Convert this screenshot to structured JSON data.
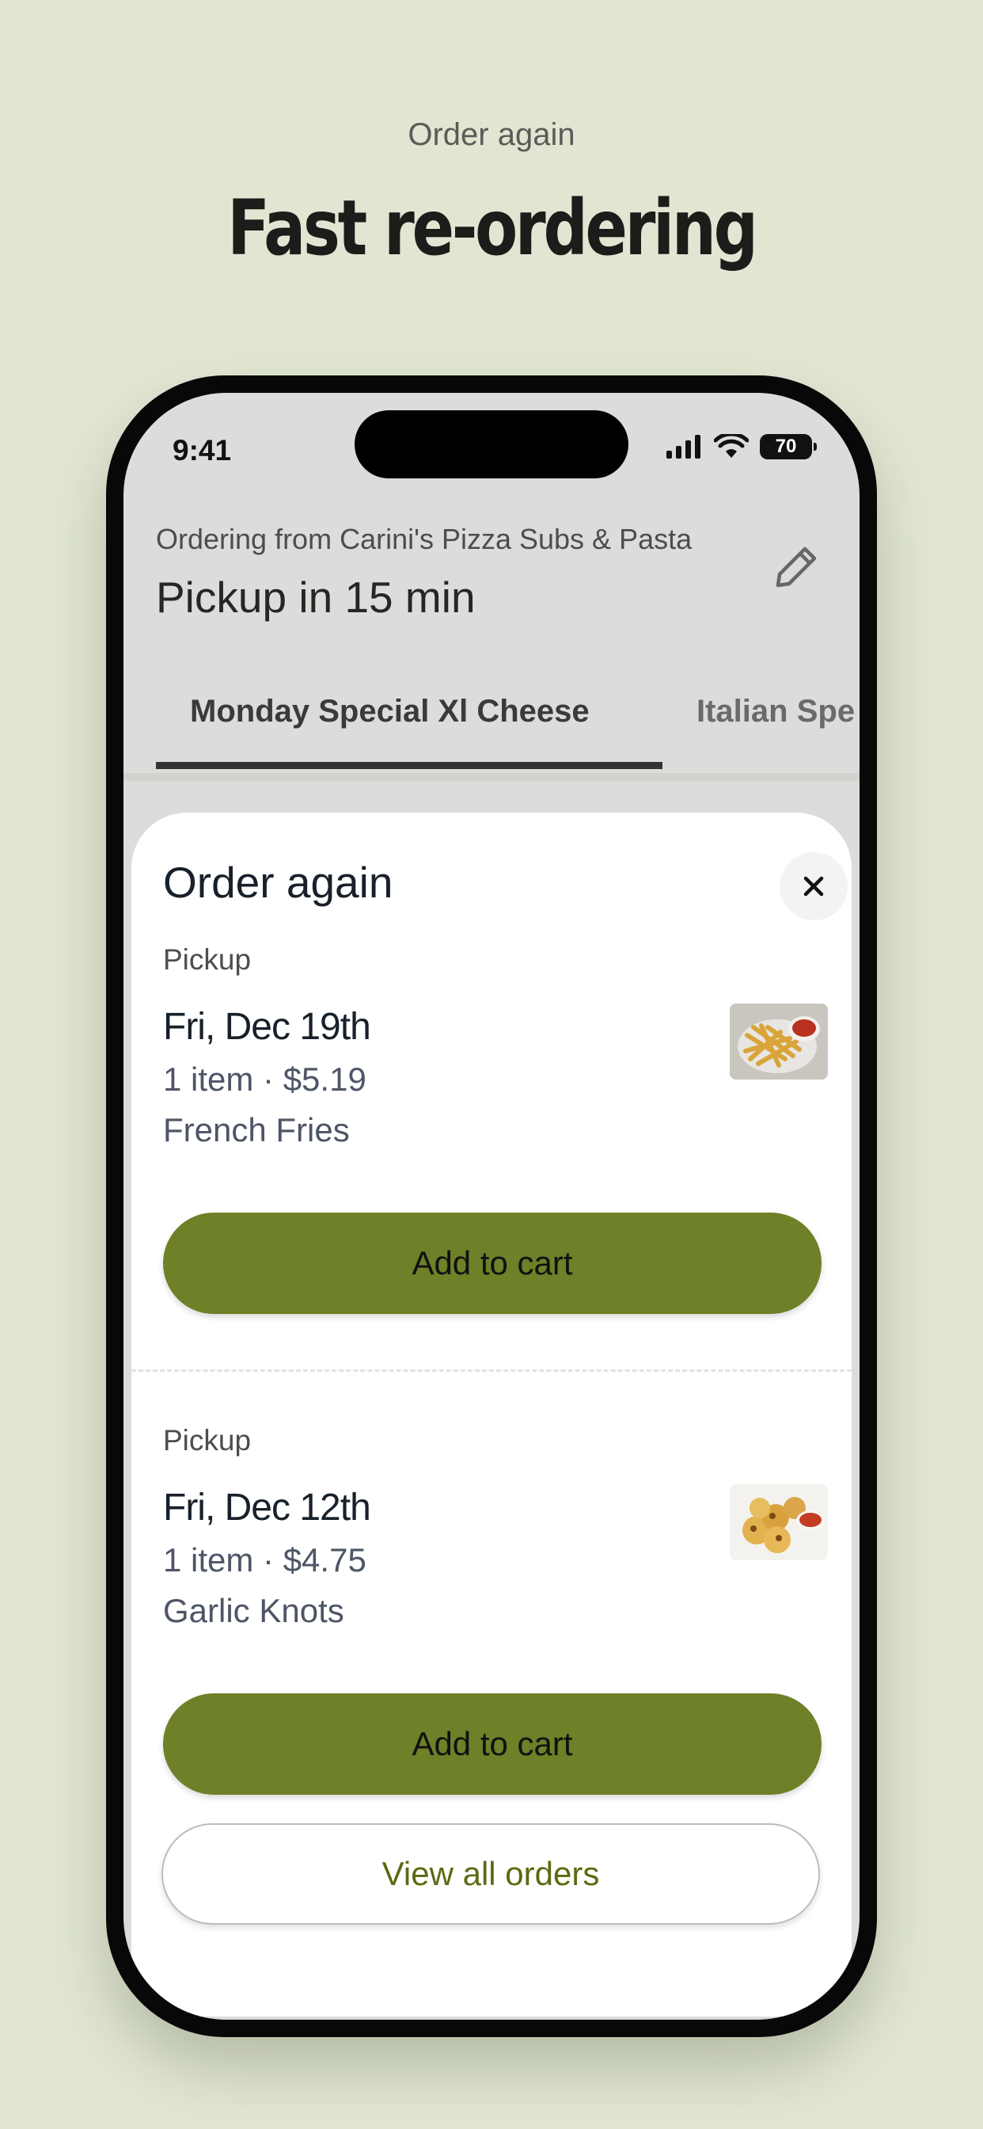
{
  "marketing": {
    "eyebrow": "Order again",
    "headline": "Fast re-ordering"
  },
  "status_bar": {
    "time": "9:41",
    "battery": "70",
    "icons": [
      "signal-icon",
      "wifi-icon",
      "battery-icon"
    ]
  },
  "header": {
    "ordering_from": "Ordering from Carini's Pizza Subs & Pasta",
    "pickup_time": "Pickup in 15 min",
    "edit_icon": "pencil-icon"
  },
  "tabs": [
    {
      "label": "Monday Special Xl Cheese",
      "active": true
    },
    {
      "label": "Italian Spe",
      "active": false
    }
  ],
  "sheet": {
    "title": "Order again",
    "close_icon": "close-icon",
    "orders": [
      {
        "type": "Pickup",
        "date": "Fri, Dec 19th",
        "summary": "1 item · $5.19",
        "items": "French Fries",
        "thumb": "french-fries-thumbnail",
        "button": "Add to cart"
      },
      {
        "type": "Pickup",
        "date": "Fri, Dec 12th",
        "summary": "1 item · $4.75",
        "items": "Garlic Knots",
        "thumb": "garlic-knots-thumbnail",
        "button": "Add to cart"
      }
    ],
    "view_all": "View all orders"
  },
  "colors": {
    "background": "#e1e6d3",
    "accent": "#6e8028",
    "accent_text": "#5a6b12"
  }
}
